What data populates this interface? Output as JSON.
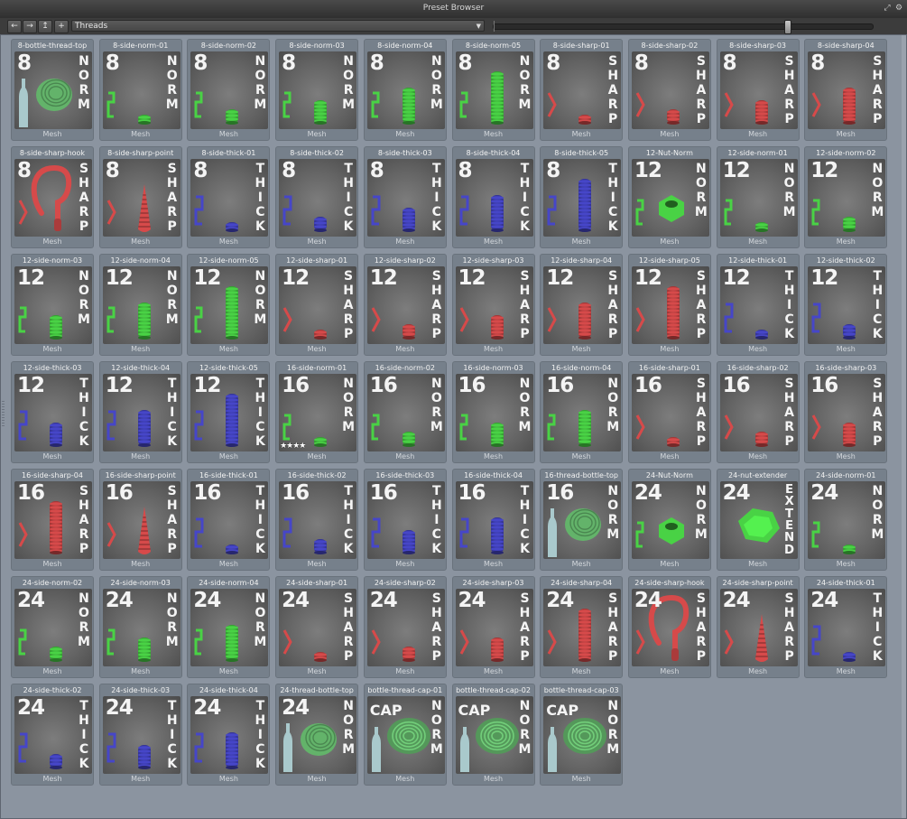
{
  "window": {
    "title": "Preset Browser"
  },
  "toolbar": {
    "path": "Threads",
    "back_icon": "arrow-left-icon",
    "forward_icon": "arrow-right-icon",
    "up_icon": "folder-up-icon",
    "add_icon": "plus-icon"
  },
  "colors": {
    "norm": "#49d245",
    "sharp": "#d64a4a",
    "thick": "#4646c8",
    "thread_green": "#63b36a",
    "bottle": "#a9c9cc"
  },
  "presets": [
    {
      "name": "8-bottle-thread-top",
      "type": "Mesh",
      "num": "8",
      "word": "NORM",
      "cat": "norm",
      "kind": "bottle",
      "size": 0
    },
    {
      "name": "8-side-norm-01",
      "type": "Mesh",
      "num": "8",
      "word": "NORM",
      "cat": "norm",
      "kind": "screw",
      "size": 1
    },
    {
      "name": "8-side-norm-02",
      "type": "Mesh",
      "num": "8",
      "word": "NORM",
      "cat": "norm",
      "kind": "screw",
      "size": 2
    },
    {
      "name": "8-side-norm-03",
      "type": "Mesh",
      "num": "8",
      "word": "NORM",
      "cat": "norm",
      "kind": "screw",
      "size": 3
    },
    {
      "name": "8-side-norm-04",
      "type": "Mesh",
      "num": "8",
      "word": "NORM",
      "cat": "norm",
      "kind": "screw",
      "size": 4
    },
    {
      "name": "8-side-norm-05",
      "type": "Mesh",
      "num": "8",
      "word": "NORM",
      "cat": "norm",
      "kind": "screw",
      "size": 5
    },
    {
      "name": "8-side-sharp-01",
      "type": "Mesh",
      "num": "8",
      "word": "SHARP",
      "cat": "sharp",
      "kind": "screw",
      "size": 1
    },
    {
      "name": "8-side-sharp-02",
      "type": "Mesh",
      "num": "8",
      "word": "SHARP",
      "cat": "sharp",
      "kind": "screw",
      "size": 2
    },
    {
      "name": "8-side-sharp-03",
      "type": "Mesh",
      "num": "8",
      "word": "SHARP",
      "cat": "sharp",
      "kind": "screw",
      "size": 3
    },
    {
      "name": "8-side-sharp-04",
      "type": "Mesh",
      "num": "8",
      "word": "SHARP",
      "cat": "sharp",
      "kind": "screw",
      "size": 4
    },
    {
      "name": "8-side-sharp-hook",
      "type": "Mesh",
      "num": "8",
      "word": "SHARP",
      "cat": "sharp",
      "kind": "hook",
      "size": 0
    },
    {
      "name": "8-side-sharp-point",
      "type": "Mesh",
      "num": "8",
      "word": "SHARP",
      "cat": "sharp",
      "kind": "point",
      "size": 0
    },
    {
      "name": "8-side-thick-01",
      "type": "Mesh",
      "num": "8",
      "word": "THICK",
      "cat": "thick",
      "kind": "screw",
      "size": 1
    },
    {
      "name": "8-side-thick-02",
      "type": "Mesh",
      "num": "8",
      "word": "THICK",
      "cat": "thick",
      "kind": "screw",
      "size": 2
    },
    {
      "name": "8-side-thick-03",
      "type": "Mesh",
      "num": "8",
      "word": "THICK",
      "cat": "thick",
      "kind": "screw",
      "size": 3
    },
    {
      "name": "8-side-thick-04",
      "type": "Mesh",
      "num": "8",
      "word": "THICK",
      "cat": "thick",
      "kind": "screw",
      "size": 4
    },
    {
      "name": "8-side-thick-05",
      "type": "Mesh",
      "num": "8",
      "word": "THICK",
      "cat": "thick",
      "kind": "screw",
      "size": 5
    },
    {
      "name": "12-Nut-Norm",
      "type": "Mesh",
      "num": "12",
      "word": "NORM",
      "cat": "norm",
      "kind": "nut",
      "size": 0
    },
    {
      "name": "12-side-norm-01",
      "type": "Mesh",
      "num": "12",
      "word": "NORM",
      "cat": "norm",
      "kind": "screw",
      "size": 1
    },
    {
      "name": "12-side-norm-02",
      "type": "Mesh",
      "num": "12",
      "word": "NORM",
      "cat": "norm",
      "kind": "screw",
      "size": 2
    },
    {
      "name": "12-side-norm-03",
      "type": "Mesh",
      "num": "12",
      "word": "NORM",
      "cat": "norm",
      "kind": "screw",
      "size": 3
    },
    {
      "name": "12-side-norm-04",
      "type": "Mesh",
      "num": "12",
      "word": "NORM",
      "cat": "norm",
      "kind": "screw",
      "size": 4
    },
    {
      "name": "12-side-norm-05",
      "type": "Mesh",
      "num": "12",
      "word": "NORM",
      "cat": "norm",
      "kind": "screw",
      "size": 5
    },
    {
      "name": "12-side-sharp-01",
      "type": "Mesh",
      "num": "12",
      "word": "SHARP",
      "cat": "sharp",
      "kind": "screw",
      "size": 1
    },
    {
      "name": "12-side-sharp-02",
      "type": "Mesh",
      "num": "12",
      "word": "SHARP",
      "cat": "sharp",
      "kind": "screw",
      "size": 2
    },
    {
      "name": "12-side-sharp-03",
      "type": "Mesh",
      "num": "12",
      "word": "SHARP",
      "cat": "sharp",
      "kind": "screw",
      "size": 3
    },
    {
      "name": "12-side-sharp-04",
      "type": "Mesh",
      "num": "12",
      "word": "SHARP",
      "cat": "sharp",
      "kind": "screw",
      "size": 4
    },
    {
      "name": "12-side-sharp-05",
      "type": "Mesh",
      "num": "12",
      "word": "SHARP",
      "cat": "sharp",
      "kind": "screw",
      "size": 5
    },
    {
      "name": "12-side-thick-01",
      "type": "Mesh",
      "num": "12",
      "word": "THICK",
      "cat": "thick",
      "kind": "screw",
      "size": 1
    },
    {
      "name": "12-side-thick-02",
      "type": "Mesh",
      "num": "12",
      "word": "THICK",
      "cat": "thick",
      "kind": "screw",
      "size": 2
    },
    {
      "name": "12-side-thick-03",
      "type": "Mesh",
      "num": "12",
      "word": "THICK",
      "cat": "thick",
      "kind": "screw",
      "size": 3
    },
    {
      "name": "12-side-thick-04",
      "type": "Mesh",
      "num": "12",
      "word": "THICK",
      "cat": "thick",
      "kind": "screw",
      "size": 4
    },
    {
      "name": "12-side-thick-05",
      "type": "Mesh",
      "num": "12",
      "word": "THICK",
      "cat": "thick",
      "kind": "screw",
      "size": 5
    },
    {
      "name": "16-side-norm-01",
      "type": "Mesh",
      "num": "16",
      "word": "NORM",
      "cat": "norm",
      "kind": "screw",
      "size": 1,
      "stars": "★★★★"
    },
    {
      "name": "16-side-norm-02",
      "type": "Mesh",
      "num": "16",
      "word": "NORM",
      "cat": "norm",
      "kind": "screw",
      "size": 2
    },
    {
      "name": "16-side-norm-03",
      "type": "Mesh",
      "num": "16",
      "word": "NORM",
      "cat": "norm",
      "kind": "screw",
      "size": 3
    },
    {
      "name": "16-side-norm-04",
      "type": "Mesh",
      "num": "16",
      "word": "NORM",
      "cat": "norm",
      "kind": "screw",
      "size": 4
    },
    {
      "name": "16-side-sharp-01",
      "type": "Mesh",
      "num": "16",
      "word": "SHARP",
      "cat": "sharp",
      "kind": "screw",
      "size": 1
    },
    {
      "name": "16-side-sharp-02",
      "type": "Mesh",
      "num": "16",
      "word": "SHARP",
      "cat": "sharp",
      "kind": "screw",
      "size": 2
    },
    {
      "name": "16-side-sharp-03",
      "type": "Mesh",
      "num": "16",
      "word": "SHARP",
      "cat": "sharp",
      "kind": "screw",
      "size": 3
    },
    {
      "name": "16-side-sharp-04",
      "type": "Mesh",
      "num": "16",
      "word": "SHARP",
      "cat": "sharp",
      "kind": "screw",
      "size": 5
    },
    {
      "name": "16-side-sharp-point",
      "type": "Mesh",
      "num": "16",
      "word": "SHARP",
      "cat": "sharp",
      "kind": "point",
      "size": 0
    },
    {
      "name": "16-side-thick-01",
      "type": "Mesh",
      "num": "16",
      "word": "THICK",
      "cat": "thick",
      "kind": "screw",
      "size": 1
    },
    {
      "name": "16-side-thick-02",
      "type": "Mesh",
      "num": "16",
      "word": "THICK",
      "cat": "thick",
      "kind": "screw",
      "size": 2
    },
    {
      "name": "16-side-thick-03",
      "type": "Mesh",
      "num": "16",
      "word": "THICK",
      "cat": "thick",
      "kind": "screw",
      "size": 3
    },
    {
      "name": "16-side-thick-04",
      "type": "Mesh",
      "num": "16",
      "word": "THICK",
      "cat": "thick",
      "kind": "screw",
      "size": 4
    },
    {
      "name": "16-thread-bottle-top",
      "type": "Mesh",
      "num": "16",
      "word": "NORM",
      "cat": "norm",
      "kind": "bottle",
      "size": 0
    },
    {
      "name": "24-Nut-Norm",
      "type": "Mesh",
      "num": "24",
      "word": "NORM",
      "cat": "norm",
      "kind": "nut",
      "size": 0
    },
    {
      "name": "24-nut-extender",
      "type": "Mesh",
      "num": "24",
      "word": "EXTEND",
      "cat": "norm",
      "kind": "extender",
      "size": 0
    },
    {
      "name": "24-side-norm-01",
      "type": "Mesh",
      "num": "24",
      "word": "NORM",
      "cat": "norm",
      "kind": "screw",
      "size": 1
    },
    {
      "name": "24-side-norm-02",
      "type": "Mesh",
      "num": "24",
      "word": "NORM",
      "cat": "norm",
      "kind": "screw",
      "size": 2
    },
    {
      "name": "24-side-norm-03",
      "type": "Mesh",
      "num": "24",
      "word": "NORM",
      "cat": "norm",
      "kind": "screw",
      "size": 3
    },
    {
      "name": "24-side-norm-04",
      "type": "Mesh",
      "num": "24",
      "word": "NORM",
      "cat": "norm",
      "kind": "screw",
      "size": 4
    },
    {
      "name": "24-side-sharp-01",
      "type": "Mesh",
      "num": "24",
      "word": "SHARP",
      "cat": "sharp",
      "kind": "screw",
      "size": 1
    },
    {
      "name": "24-side-sharp-02",
      "type": "Mesh",
      "num": "24",
      "word": "SHARP",
      "cat": "sharp",
      "kind": "screw",
      "size": 2
    },
    {
      "name": "24-side-sharp-03",
      "type": "Mesh",
      "num": "24",
      "word": "SHARP",
      "cat": "sharp",
      "kind": "screw",
      "size": 3
    },
    {
      "name": "24-side-sharp-04",
      "type": "Mesh",
      "num": "24",
      "word": "SHARP",
      "cat": "sharp",
      "kind": "screw",
      "size": 5
    },
    {
      "name": "24-side-sharp-hook",
      "type": "Mesh",
      "num": "24",
      "word": "SHARP",
      "cat": "sharp",
      "kind": "hook",
      "size": 0
    },
    {
      "name": "24-side-sharp-point",
      "type": "Mesh",
      "num": "24",
      "word": "SHARP",
      "cat": "sharp",
      "kind": "point",
      "size": 0
    },
    {
      "name": "24-side-thick-01",
      "type": "Mesh",
      "num": "24",
      "word": "THICK",
      "cat": "thick",
      "kind": "screw",
      "size": 1
    },
    {
      "name": "24-side-thick-02",
      "type": "Mesh",
      "num": "24",
      "word": "THICK",
      "cat": "thick",
      "kind": "screw",
      "size": 2
    },
    {
      "name": "24-side-thick-03",
      "type": "Mesh",
      "num": "24",
      "word": "THICK",
      "cat": "thick",
      "kind": "screw",
      "size": 3
    },
    {
      "name": "24-side-thick-04",
      "type": "Mesh",
      "num": "24",
      "word": "THICK",
      "cat": "thick",
      "kind": "screw",
      "size": 4
    },
    {
      "name": "24-thread-bottle-top",
      "type": "Mesh",
      "num": "24",
      "word": "NORM",
      "cat": "norm",
      "kind": "bottle",
      "size": 0
    },
    {
      "name": "bottle-thread-cap-01",
      "type": "Mesh",
      "num": "CAP",
      "word": "NORM",
      "cat": "norm",
      "kind": "cap",
      "size": 0
    },
    {
      "name": "bottle-thread-cap-02",
      "type": "Mesh",
      "num": "CAP",
      "word": "NORM",
      "cat": "norm",
      "kind": "cap",
      "size": 0
    },
    {
      "name": "bottle-thread-cap-03",
      "type": "Mesh",
      "num": "CAP",
      "word": "NORM",
      "cat": "norm",
      "kind": "cap",
      "size": 0
    }
  ]
}
